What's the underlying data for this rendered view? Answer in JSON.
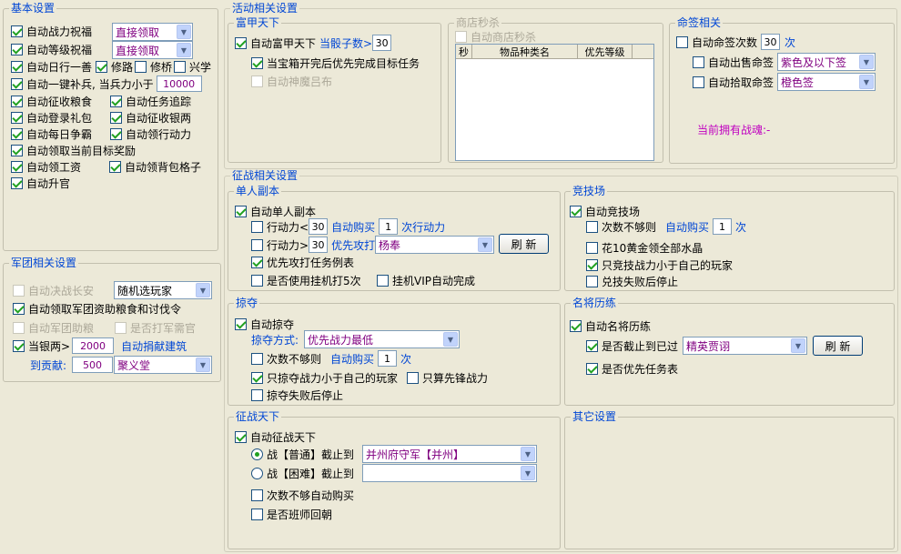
{
  "basic": {
    "title": "基本设置",
    "zhanli": {
      "label": "自动战力祝福",
      "value": "直接领取"
    },
    "dengji": {
      "label": "自动等级祝福",
      "value": "直接领取"
    },
    "rixing": {
      "label": "自动日行一善",
      "xiulu": "修路",
      "xiuqiao": "修桥",
      "xingxue": "兴学"
    },
    "bubing": {
      "label": "自动一键补兵, 当兵力小于",
      "value": "10000"
    },
    "zhengshou_liang": "自动征收粮食",
    "renwu_zhuizong": "自动任务追踪",
    "denglu_libao": "自动登录礼包",
    "zhengshou_yin": "自动征收银两",
    "meiri_zhengba": "自动每日争霸",
    "xingdongli": "自动领行动力",
    "mubiao_jiangli": "自动领取当前目标奖励",
    "gongzi": "自动领工资",
    "beibao": "自动领背包格子",
    "shengguan": "自动升官"
  },
  "legion": {
    "title": "军团相关设置",
    "juezhan": {
      "label": "自动决战长安",
      "value": "随机选玩家"
    },
    "zizhu": "自动领取军团资助粮食和讨伐令",
    "bangliang": "自动军团助粮",
    "junxu": "是否打军需官",
    "dangyin": {
      "label": "当银两>",
      "value": "2000",
      "action": "自动捐献建筑"
    },
    "gongxian": {
      "label": "到贡献:",
      "value": "500",
      "building": "聚义堂"
    }
  },
  "activity": {
    "title": "活动相关设置",
    "fujia": {
      "title": "富甲天下",
      "auto": "自动富甲天下",
      "dice_label": "当骰子数>",
      "dice_value": "30",
      "priority": "当宝箱开完后优先完成目标任务",
      "shenmo": "自动神魔吕布"
    },
    "shop": {
      "title": "商店秒杀",
      "auto": "自动商店秒杀",
      "headers": [
        "秒",
        "物品种类名",
        "优先等级"
      ]
    },
    "mingqian": {
      "title": "命签相关",
      "auto_label": "自动命签次数",
      "auto_value": "30",
      "auto_unit": "次",
      "sell_label": "自动出售命签",
      "sell_value": "紫色及以下签",
      "pick_label": "自动拾取命签",
      "pick_value": "橙色签",
      "current": "当前拥有战魂:-"
    }
  },
  "battle": {
    "title": "征战相关设置",
    "single": {
      "title": "单人副本",
      "auto": "自动单人副本",
      "row1": {
        "label": "行动力<",
        "value": "30",
        "buy": "自动购买",
        "count": "1",
        "unit": "次行动力"
      },
      "row2": {
        "label": "行动力>",
        "value": "30",
        "attack": "优先攻打",
        "target": "杨奉",
        "refresh": "刷 新"
      },
      "priority": "优先攻打任务例表",
      "hangup": "是否使用挂机打5次",
      "vip": "挂机VIP自动完成"
    },
    "arena": {
      "title": "竞技场",
      "auto": "自动竞技场",
      "notenough": "次数不够则",
      "buy": "自动购买",
      "count": "1",
      "unit": "次",
      "gold": "花10黄金领全部水晶",
      "weaker": "只竞技战力小于自己的玩家",
      "stop": "兑技失败后停止"
    },
    "plunder": {
      "title": "掠夺",
      "auto": "自动掠夺",
      "mode_label": "掠夺方式:",
      "mode_value": "优先战力最低",
      "notenough": "次数不够则",
      "buy": "自动购买",
      "count": "1",
      "unit": "次",
      "weaker": "只掠夺战力小于自己的玩家",
      "vanguard": "只算先锋战力",
      "stop": "掠夺失败后停止"
    },
    "famous": {
      "title": "名将历练",
      "auto": "自动名将历练",
      "stop_label": "是否截止到已过",
      "stop_value": "精英贾诩",
      "refresh": "刷 新",
      "priority": "是否优先任务表"
    },
    "conquer": {
      "title": "征战天下",
      "auto": "自动征战天下",
      "normal_label": "战【普通】截止到",
      "normal_value": "并州府守军【并州】",
      "hard_label": "战【困难】截止到",
      "hard_value": "",
      "buy": "次数不够自动购买",
      "return": "是否班师回朝"
    },
    "other": {
      "title": "其它设置"
    }
  }
}
